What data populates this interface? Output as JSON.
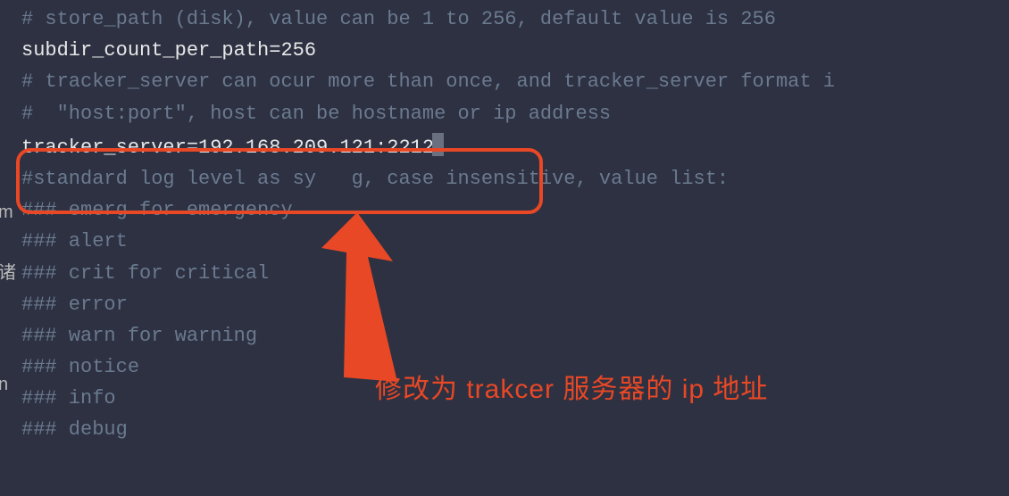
{
  "lines": {
    "l1": "# store_path (disk), value can be 1 to 256, default value is 256",
    "l2": "subdir_count_per_path=256",
    "l3": "",
    "l4": "# tracker_server can ocur more than once, and tracker_server format i",
    "l5": "#  \"host:port\", host can be hostname or ip address",
    "l6_prefix": "tracker_server=192.168.209.121:2212",
    "l6_cursor_char": "2",
    "l7": "",
    "l8": "#standard log level as sy   g, case insensitive, value list:",
    "l9": "### emerg for emergency",
    "l10": "### alert",
    "l11": "### crit for critical",
    "l12": "### error",
    "l13": "### warn for warning",
    "l14": "### notice",
    "l15": "### info",
    "l16": "### debug"
  },
  "margin": {
    "m1": "m",
    "zhu": "诸",
    "n": "n"
  },
  "annotation": "修改为 trakcer 服务器的 ip 地址",
  "colors": {
    "highlight": "#e84825",
    "bg": "#2d3142",
    "comment": "#6b7a8f",
    "text": "#e8e8e8"
  }
}
